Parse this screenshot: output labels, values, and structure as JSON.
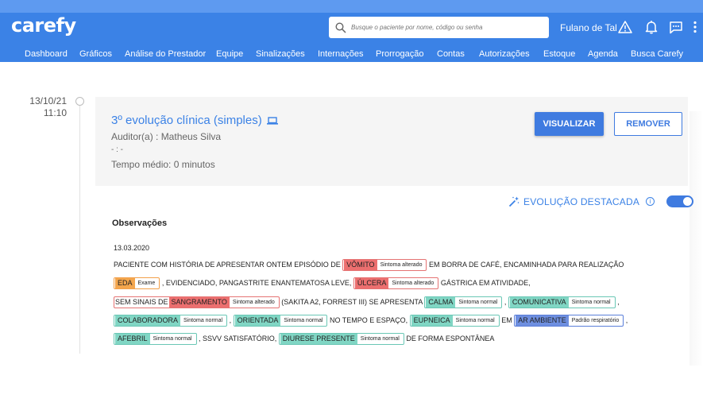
{
  "app": {
    "logo": "carefy",
    "search_placeholder": "Busque o paciente por nome, código ou senha",
    "user_name": "Fulano de Tal",
    "icons": [
      "search-icon",
      "warning-icon",
      "bell-icon",
      "chat-icon",
      "more-vert-icon"
    ]
  },
  "nav": {
    "items": [
      "Dashboard",
      "Gráficos",
      "Análise do Prestador",
      "Equipe",
      "Sinalizações",
      "Internações",
      "Prorrogação",
      "Contas",
      "Autorizações",
      "Estoque",
      "Agenda",
      "Busca Carefy"
    ]
  },
  "timeline": {
    "date": "13/10/21",
    "time": "11:10"
  },
  "card": {
    "title": "3º evolução clínica (simples)",
    "auditor": "Auditor(a) : Matheus Silva",
    "dash_line": "- : -",
    "avg_time": "Tempo médio: 0 minutos",
    "view_button": "VISUALIZAR",
    "remove_button": "REMOVER"
  },
  "highlight": {
    "label": "EVOLUÇÃO DESTACADA",
    "info": "i",
    "toggle_on": true
  },
  "observations": {
    "title": "Observações",
    "date": "13.03.2020",
    "t1": "PACIENTE COM HISTÓRIA DE APRESENTAR ONTEM EPISÓDIO DE ",
    "tag_vomito": "VÔMITO",
    "cat_vomito": "Sintoma alterado",
    "t2": " EM BORRA DE CAFÉ, ENCAMINHADA PARA REALIZAÇÃO ",
    "tag_eda": "EDA",
    "cat_eda": "Exame",
    "t3": " , EVIDENCIADO, PANGASTRITE ENANTEMATOSA LEVE, ",
    "tag_ulcera": "ÚLCERA",
    "cat_ulcera": "Sintoma alterado",
    "t4": " GÁSTRICA EM ATIVIDADE, ",
    "t_sem": "SEM SINAIS DE ",
    "tag_sangramento": "SANGRAMENTO",
    "cat_sangramento": "Sintoma alterado",
    "t5": " (SAKITA A2, FORREST III) SE APRESENTA ",
    "tag_calma": "CALMA",
    "cat_calma": "Sintoma normal",
    "t6": " , ",
    "tag_comunicativa": "COMUNICATIVA",
    "cat_comunicativa": "Sintoma normal",
    "t7": " , ",
    "tag_colaboradora": "COLABORADORA",
    "cat_colaboradora": "Sintoma normal",
    "t8": " , ",
    "tag_orientada": "ORIENTADA",
    "cat_orientada": "Sintoma normal",
    "t9": " NO TEMPO E ESPAÇO, ",
    "tag_eupneica": "EUPNEICA",
    "cat_eupneica": "Sintoma normal",
    "t10": " EM ",
    "tag_ar": "AR AMBIENTE",
    "cat_ar": "Padrão respiratório",
    "t11": " , ",
    "tag_afebril": "AFEBRIL",
    "cat_afebril": "Sintoma normal",
    "t12": " , SSVV SATISFATÓRIO, ",
    "tag_diurese": "DIURESE PRESENTE",
    "cat_diurese": "Sintoma normal",
    "t13": " DE FORMA ESPONTÂNEA"
  },
  "colors": {
    "header": "#3b82e6",
    "primary": "#3f7be0",
    "altered": "#ec6f6f",
    "normal": "#80d6c4",
    "exam": "#f4a64d",
    "respiratory": "#6e8fe0"
  }
}
